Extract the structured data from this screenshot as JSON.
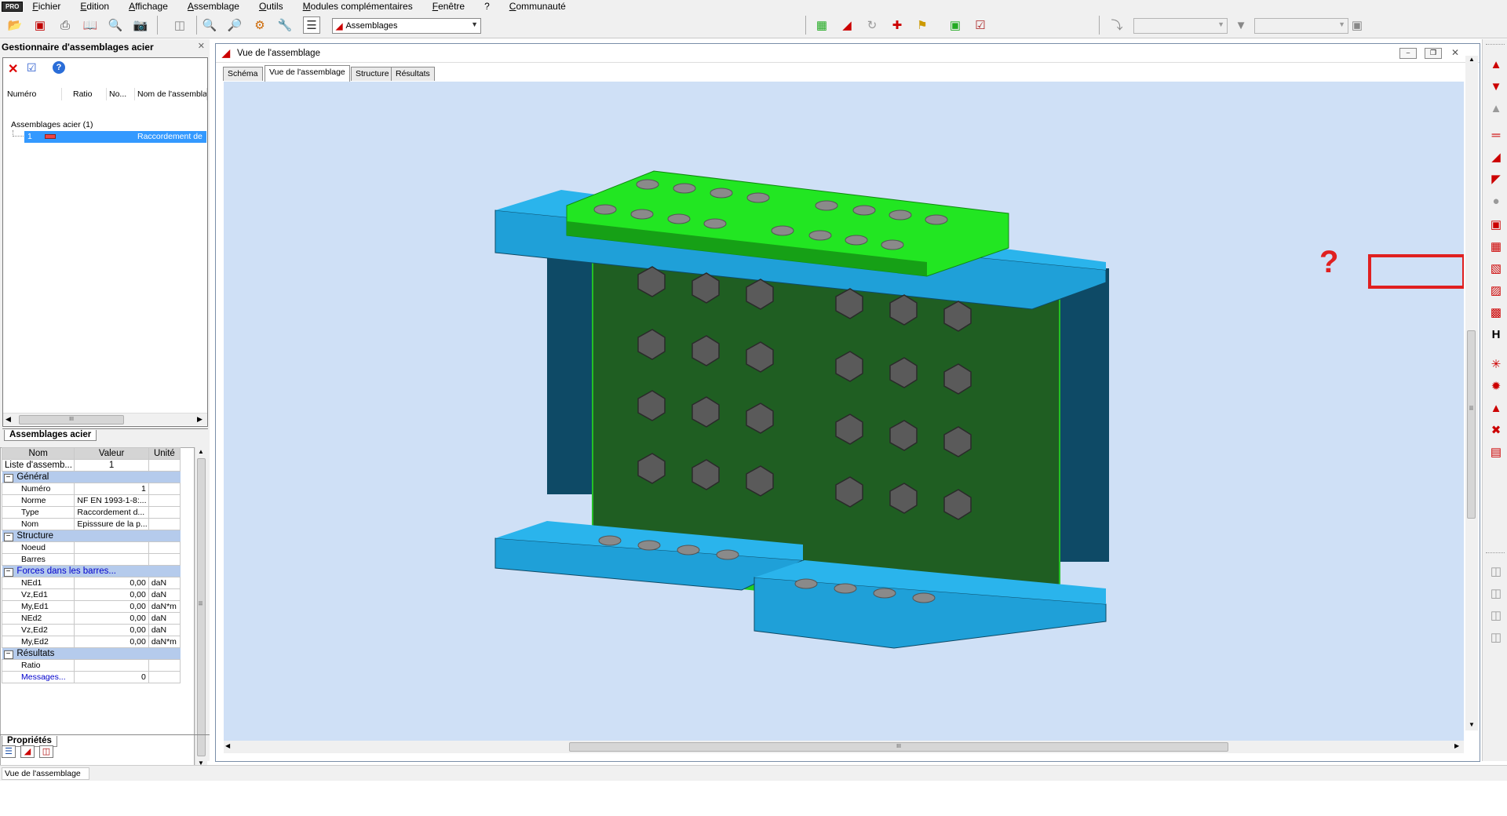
{
  "menubar": {
    "badge": "PRO",
    "items": [
      "Fichier",
      "Edition",
      "Affichage",
      "Assemblage",
      "Outils",
      "Modules complémentaires",
      "Fenêtre",
      "?",
      "Communauté"
    ]
  },
  "toolbar": {
    "combo_assemblages": "Assemblages",
    "combo_disabled_1": "",
    "combo_disabled_2": ""
  },
  "manager": {
    "title": "Gestionnaire d'assemblages acier",
    "columns": [
      "Numéro",
      "Ratio",
      "No...",
      "Nom de l'assembla"
    ],
    "tree_root": "Assemblages acier (1)",
    "row_number": "1",
    "row_name": "Raccordement de",
    "tab_label": "Assemblages acier",
    "scroll_mark": "III"
  },
  "properties": {
    "headers": [
      "Nom",
      "Valeur",
      "Unité"
    ],
    "list_label": "Liste d'assemb...",
    "list_value": "1",
    "groups": {
      "general": "Général",
      "structure": "Structure",
      "forces": "Forces dans les barres...",
      "results": "Résultats"
    },
    "general_rows": [
      {
        "name": "Numéro",
        "value": "1",
        "unit": ""
      },
      {
        "name": "Norme",
        "value": "NF EN 1993-1-8:...",
        "unit": ""
      },
      {
        "name": "Type",
        "value": "Raccordement d...",
        "unit": ""
      },
      {
        "name": "Nom",
        "value": "Episssure de la p...",
        "unit": ""
      }
    ],
    "structure_rows": [
      {
        "name": "Noeud",
        "value": "",
        "unit": ""
      },
      {
        "name": "Barres",
        "value": "",
        "unit": ""
      }
    ],
    "force_rows": [
      {
        "name": "NEd1",
        "value": "0,00",
        "unit": "daN"
      },
      {
        "name": "Vz,Ed1",
        "value": "0,00",
        "unit": "daN"
      },
      {
        "name": "My,Ed1",
        "value": "0,00",
        "unit": "daN*m"
      },
      {
        "name": "NEd2",
        "value": "0,00",
        "unit": "daN"
      },
      {
        "name": "Vz,Ed2",
        "value": "0,00",
        "unit": "daN"
      },
      {
        "name": "My,Ed2",
        "value": "0,00",
        "unit": "daN*m"
      }
    ],
    "result_rows": [
      {
        "name": "Ratio",
        "value": "",
        "unit": ""
      },
      {
        "name": "Messages...",
        "value": "0",
        "unit": ""
      }
    ],
    "tab_label": "Propriétés",
    "scroll_mark": "III"
  },
  "view": {
    "window_title": "Vue de l'assemblage",
    "tabs": [
      "Schéma",
      "Vue de l'assemblage",
      "Structure",
      "Résultats"
    ],
    "active_tab": 1,
    "annotation": "?",
    "hscroll_mark": "III",
    "vscroll_mark": "III"
  },
  "statusbar": {
    "text": "Vue de l'assemblage"
  },
  "colors": {
    "beam_blue": "#1fa0d8",
    "beam_dark": "#0e4a66",
    "plate_green": "#1ee61e",
    "web_plate": "#1f5e22",
    "bolt_gray": "#5a5a5a",
    "highlight_red": "#e02020",
    "selection_blue": "#3399ff",
    "viewport_bg": "#cfe0f6"
  },
  "icons": {
    "right_palette": [
      "column-base-icon",
      "beam-column-icon",
      "splice-icon",
      "knee-icon",
      "haunch-icon",
      "beam-splice-icon",
      "fin-plate-icon",
      "gusset-icon",
      "angle-cleat-icon",
      "truss-node-icon",
      "anchor-icon",
      "circular-base-icon",
      "bracing-icon",
      "tower-base-icon",
      "disabled-tool-icon"
    ]
  }
}
